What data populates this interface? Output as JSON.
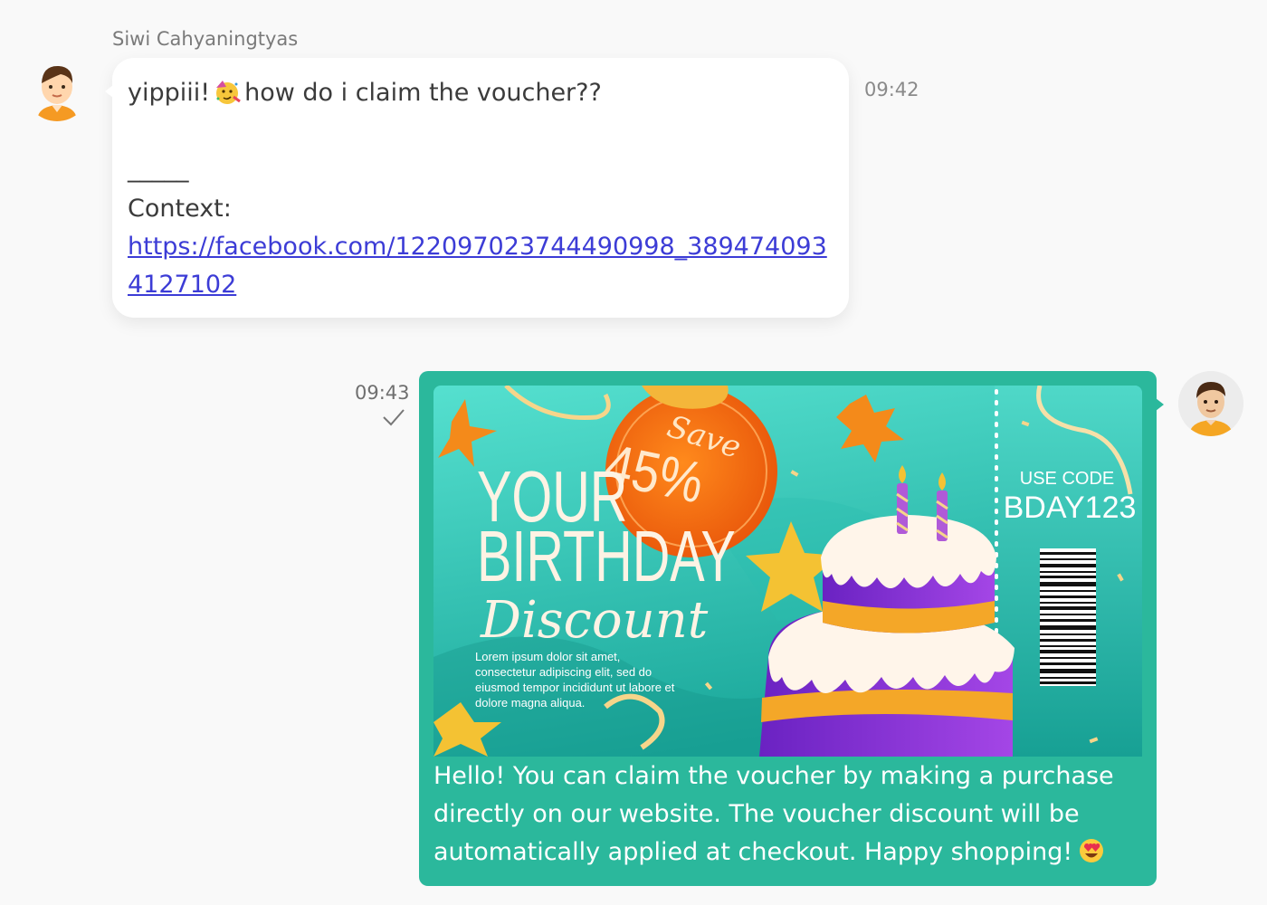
{
  "incoming": {
    "sender_name": "Siwi Cahyaningtyas",
    "text_before_emoji": "yippiii!",
    "emoji_name": "partying-face-icon",
    "text_after_emoji": "how do i claim the voucher??",
    "separator": "_____",
    "context_label": "Context:",
    "context_link": "https://facebook.com/122097023744490998_3894740934127102",
    "time": "09:42"
  },
  "outgoing": {
    "time": "09:43",
    "status_icon": "check-icon",
    "reply_text": "Hello! You can claim the voucher by making a purchase directly on our website. The voucher discount will be automatically applied at checkout. Happy shopping!",
    "reply_emoji": "heart-eyes-emoji-icon",
    "voucher": {
      "save_label": "Save",
      "percent": "45%",
      "title_line1": "YOUR",
      "title_line2": "BIRTHDAY",
      "title_script": "Discount",
      "lorem_line1": "Lorem ipsum dolor sit amet,",
      "lorem_line2": "consectetur adipiscing elit, sed do",
      "lorem_line3": "eiusmod tempor incididunt ut labore et",
      "lorem_line4": "dolore magna aliqua.",
      "use_code_label": "USE CODE",
      "code": "BDAY123"
    }
  },
  "colors": {
    "background": "#f9f9f9",
    "outgoing_bubble": "#2bb89c",
    "link": "#3c3cd6",
    "voucher_teal": "#3fcfc0",
    "badge_orange": "#f26a0c",
    "cake_purple": "#8a2fd2",
    "cake_gold": "#f4b02a"
  }
}
